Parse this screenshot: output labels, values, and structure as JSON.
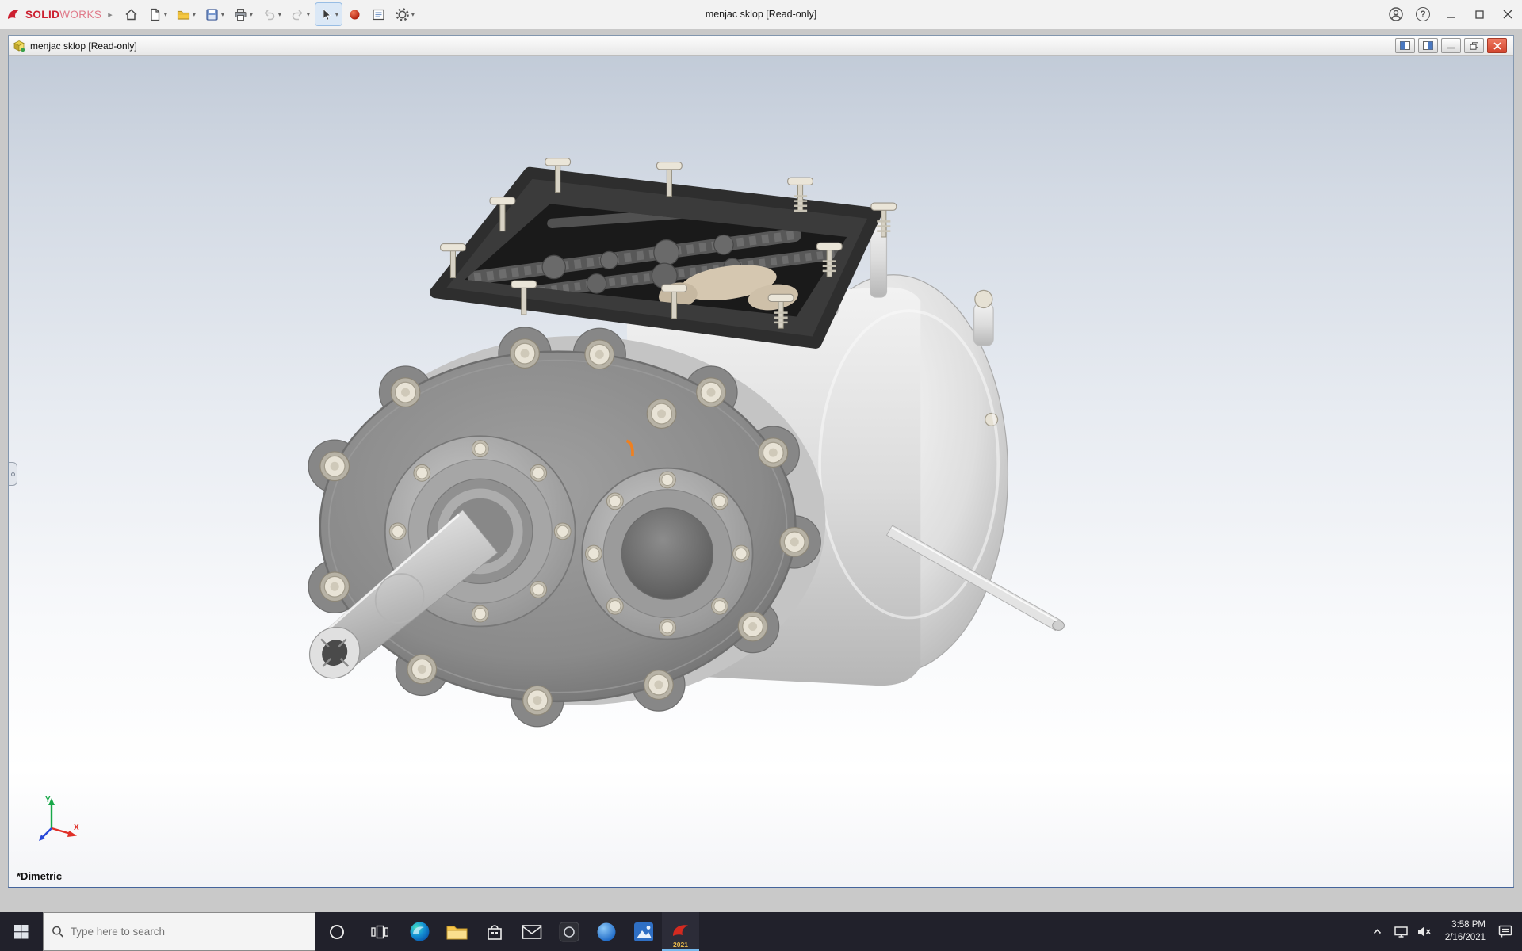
{
  "app": {
    "title": "menjac sklop [Read-only]",
    "brand": {
      "solid": "SOLID",
      "works": "WORKS"
    },
    "toolbar_tools": [
      "home",
      "new-document",
      "open",
      "save",
      "print",
      "undo",
      "redo",
      "select",
      "3dexperience",
      "task-pane",
      "options"
    ]
  },
  "doc": {
    "title": "menjac sklop [Read-only]"
  },
  "viewport": {
    "view_label": "*Dimetric",
    "triad": {
      "x": "X",
      "y": "Y"
    }
  },
  "taskbar": {
    "search_placeholder": "Type here to search",
    "clock_time": "3:58 PM",
    "clock_date": "2/16/2021",
    "solidworks_year": "2021"
  },
  "icons": {
    "expander": "▸",
    "dropdown": "▾",
    "help": "?"
  }
}
